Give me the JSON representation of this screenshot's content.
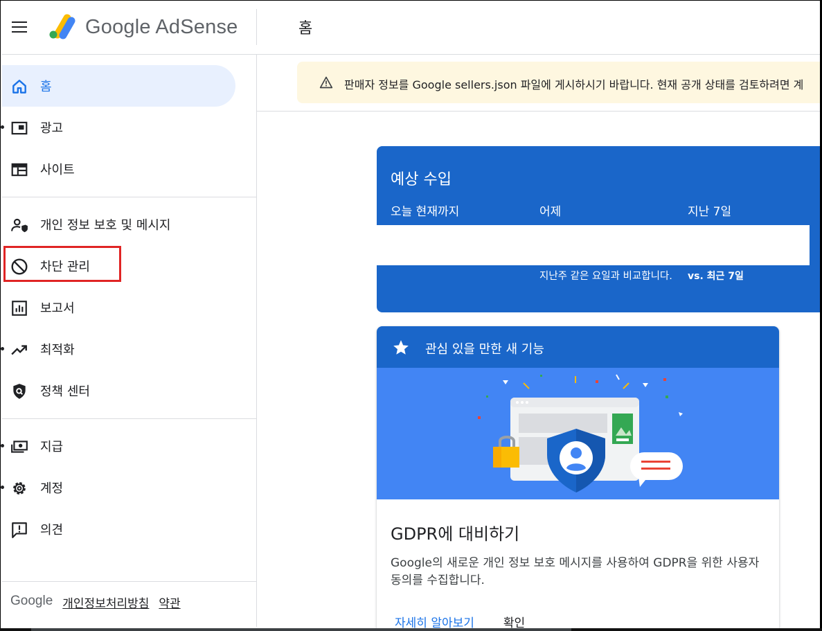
{
  "header": {
    "brand": "Google AdSense",
    "page_title": "홈"
  },
  "sidebar": {
    "items": [
      {
        "label": "홈",
        "icon": "home-icon"
      },
      {
        "label": "광고",
        "icon": "ads-icon"
      },
      {
        "label": "사이트",
        "icon": "sites-icon"
      },
      {
        "label": "개인 정보 보호 및 메시지",
        "icon": "privacy-icon"
      },
      {
        "label": "차단 관리",
        "icon": "block-icon"
      },
      {
        "label": "보고서",
        "icon": "reports-icon"
      },
      {
        "label": "최적화",
        "icon": "optimize-icon"
      },
      {
        "label": "정책 센터",
        "icon": "policy-icon"
      },
      {
        "label": "지급",
        "icon": "payments-icon"
      },
      {
        "label": "계정",
        "icon": "gear-icon"
      },
      {
        "label": "의견",
        "icon": "feedback-icon"
      }
    ],
    "footer": {
      "google": "Google",
      "privacy": "개인정보처리방침",
      "terms": "약관"
    }
  },
  "notice": {
    "text": "판매자 정보를 Google sellers.json 파일에 게시하시기 바랍니다. 현재 공개 상태를 검토하려면 계"
  },
  "earnings": {
    "title": "예상 수입",
    "columns": [
      "오늘 현재까지",
      "어제",
      "지난 7일"
    ],
    "yesterday_compare": "지난주 같은 요일과 비교합니다.",
    "week_compare": "vs. 최근 7일"
  },
  "features": {
    "header": "관심 있을 만한 새 기능",
    "title": "GDPR에 대비하기",
    "description": "Google의 새로운 개인 정보 보호 메시지를 사용하여 GDPR을 위한 사용자 동의를 수집합니다.",
    "learn_more": "자세히 알아보기",
    "confirm": "확인"
  },
  "colors": {
    "primary_blue": "#1a66c9",
    "illustration_blue": "#4285f4",
    "active_nav_bg": "#e8f0fe",
    "notice_bg": "#fef7e0",
    "highlight_red": "#e02424"
  }
}
